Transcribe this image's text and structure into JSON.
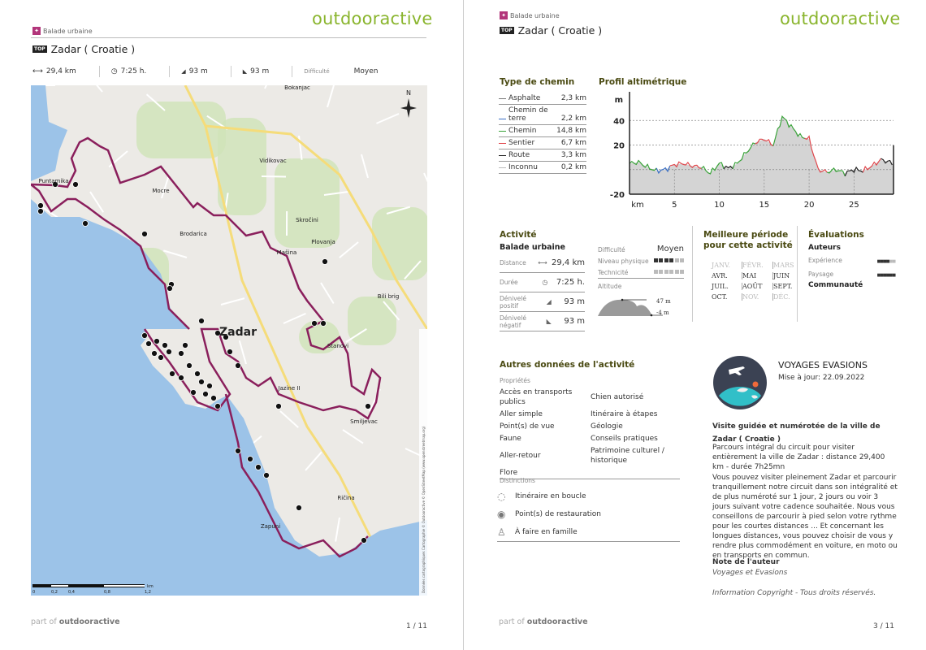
{
  "brand": "outdooractive",
  "footer": {
    "prefix": "part of",
    "brand": "outdooractive"
  },
  "page1": {
    "category": "Balade urbaine",
    "badge": "TOP",
    "title": "Zadar ( Croatie )",
    "stats": {
      "distance": "29,4 km",
      "duration": "7:25 h.",
      "ascent": "93 m",
      "descent": "93 m",
      "difficulty_label": "Difficulté",
      "difficulty": "Moyen"
    },
    "map": {
      "labels": [
        "Zadar",
        "Puntamika",
        "Mocre",
        "Brodarica",
        "Vidikovac",
        "Skročini",
        "Plovanja",
        "Mašina",
        "Bili brig",
        "Bokanjac",
        "Stanovi",
        "Jazine II",
        "Smiljevac",
        "Ričina",
        "Zapuni"
      ],
      "scale": {
        "ticks": [
          "0",
          "0,2",
          "0,4",
          "0,8",
          "1,2"
        ],
        "unit": "km"
      },
      "north": "N",
      "copyright": "Données cartographiques Cartographie © Outdooractive © OpenStreetMap (www.openstreetmap.org)",
      "colors": {
        "water": "#9cc3e8",
        "land": "#eceae6",
        "green": "#cfe3b8",
        "route": "#8a1f5c"
      }
    },
    "page_number": "1 / 11"
  },
  "page2": {
    "category": "Balade urbaine",
    "badge": "TOP",
    "title": "Zadar ( Croatie )",
    "path_types": {
      "heading": "Type de chemin",
      "items": [
        {
          "name": "Asphalte",
          "value": "2,3 km",
          "color": "#777777"
        },
        {
          "name": "Chemin de terre",
          "value": "2,2 km",
          "color": "#3a6fc4"
        },
        {
          "name": "Chemin",
          "value": "14,8 km",
          "color": "#3aa33a"
        },
        {
          "name": "Sentier",
          "value": "6,7 km",
          "color": "#e0474c"
        },
        {
          "name": "Route",
          "value": "3,3 km",
          "color": "#222222"
        },
        {
          "name": "Inconnu",
          "value": "0,2 km",
          "color": "#bbbbbb"
        }
      ]
    },
    "chart_data": {
      "type": "area",
      "title": "Profil altimétrique",
      "ylabel": "m",
      "xlabel": "km",
      "xlim": [
        0,
        29.4
      ],
      "ylim": [
        -20,
        60
      ],
      "yticks": [
        40,
        20,
        -20
      ],
      "xticks": [
        5,
        10,
        15,
        20,
        25
      ],
      "grid": true,
      "x": [
        0,
        1,
        2,
        3,
        4,
        5,
        6,
        7,
        8,
        9,
        10,
        11,
        12,
        13,
        14,
        15,
        16,
        17,
        18,
        19,
        20,
        21,
        22,
        23,
        24,
        25,
        26,
        27,
        28,
        29,
        29.4
      ],
      "y": [
        5,
        6,
        2,
        -1,
        0,
        4,
        5,
        3,
        2,
        -3,
        5,
        1,
        5,
        14,
        22,
        25,
        20,
        43,
        35,
        27,
        25,
        0,
        -2,
        0,
        -3,
        0,
        -1,
        3,
        8,
        6,
        4
      ],
      "segments": [
        {
          "from": 0,
          "to": 3,
          "type": "Chemin"
        },
        {
          "from": 3,
          "to": 4.5,
          "type": "Chemin de terre"
        },
        {
          "from": 4.5,
          "to": 8,
          "type": "Sentier"
        },
        {
          "from": 8,
          "to": 10.5,
          "type": "Chemin"
        },
        {
          "from": 10.5,
          "to": 11.5,
          "type": "Route"
        },
        {
          "from": 11.5,
          "to": 14,
          "type": "Chemin"
        },
        {
          "from": 14,
          "to": 16,
          "type": "Sentier"
        },
        {
          "from": 16,
          "to": 19.5,
          "type": "Chemin"
        },
        {
          "from": 19.5,
          "to": 22,
          "type": "Sentier"
        },
        {
          "from": 22,
          "to": 24,
          "type": "Chemin"
        },
        {
          "from": 24,
          "to": 26,
          "type": "Route"
        },
        {
          "from": 26,
          "to": 28,
          "type": "Sentier"
        },
        {
          "from": 28,
          "to": 29.4,
          "type": "Route"
        }
      ]
    },
    "activity": {
      "heading": "Activité",
      "name": "Balade urbaine",
      "rows": [
        {
          "label": "Distance",
          "value": "29,4  km"
        },
        {
          "label": "Durée",
          "value": "7:25  h."
        },
        {
          "label": "Dénivelé positif",
          "value": "93  m"
        },
        {
          "label": "Dénivelé négatif",
          "value": "93  m"
        }
      ],
      "difficulty_label": "Difficulté",
      "difficulty": "Moyen",
      "physical_label": "Niveau physique",
      "physical_level": 4,
      "physical_max": 6,
      "technique_label": "Technicité",
      "technique_level": 0,
      "technique_max": 6,
      "altitude_label": "Altitude",
      "alt_max": "47 m",
      "alt_min": "-4 m"
    },
    "season": {
      "heading": "Meilleure période pour cette activité",
      "months": [
        {
          "m": "JANV.",
          "on": false
        },
        {
          "m": "FÉVR.",
          "on": false
        },
        {
          "m": "MARS",
          "on": false
        },
        {
          "m": "AVR.",
          "on": true
        },
        {
          "m": "MAI",
          "on": true
        },
        {
          "m": "JUIN",
          "on": true
        },
        {
          "m": "JUIL.",
          "on": true
        },
        {
          "m": "AOÛT",
          "on": true
        },
        {
          "m": "SEPT.",
          "on": true
        },
        {
          "m": "OCT.",
          "on": true
        },
        {
          "m": "NOV.",
          "on": false
        },
        {
          "m": "DÉC.",
          "on": false
        }
      ]
    },
    "ratings": {
      "heading": "Évaluations",
      "authors": "Auteurs",
      "experience_label": "Expérience",
      "experience": 4,
      "landscape_label": "Paysage",
      "landscape": 6,
      "max": 6,
      "community": "Communauté"
    },
    "other": {
      "heading": "Autres données de l'activité",
      "props_label": "Propriétés",
      "props": [
        "Accès en transports publics",
        "Chien autorisé",
        "Aller simple",
        "Itinéraire à étapes",
        "Point(s) de vue",
        "Géologie",
        "Faune",
        "Conseils pratiques",
        "Aller-retour",
        "Patrimoine culturel / historique",
        "Flore"
      ],
      "dist_label": "Distinctions",
      "distinctions": [
        {
          "icon": "loop-icon",
          "label": "Itinéraire en boucle"
        },
        {
          "icon": "restaurant-icon",
          "label": "Point(s) de restauration"
        },
        {
          "icon": "family-icon",
          "label": "À faire en famille"
        }
      ]
    },
    "author": {
      "name": "VOYAGES EVASIONS",
      "updated": "Mise à jour: 22.09.2022",
      "desc_title": "Visite guidée et numérotée de la ville de Zadar ( Croatie )",
      "desc1": "Parcours intégral du circuit pour visiter entièrement la ville de Zadar : distance 29,400 km - durée 7h25mn",
      "desc2": "Vous pouvez visiter pleinement Zadar et parcourir tranquillement notre circuit dans son intégralité et de plus numéroté sur 1 jour, 2 jours ou voir 3 jours suivant votre cadence souhaitée. Nous vous conseillons de parcourir à pied selon votre rythme pour les courtes distances ... Et concernant les longues distances, vous pouvez choisir de vous y rendre plus commodément en voiture, en moto ou en transports en commun.",
      "note_title": "Note de l'auteur",
      "note": "Voyages et Evasions",
      "copyright": "Information Copyright - Tous droits réservés."
    },
    "page_number": "3 / 11"
  }
}
